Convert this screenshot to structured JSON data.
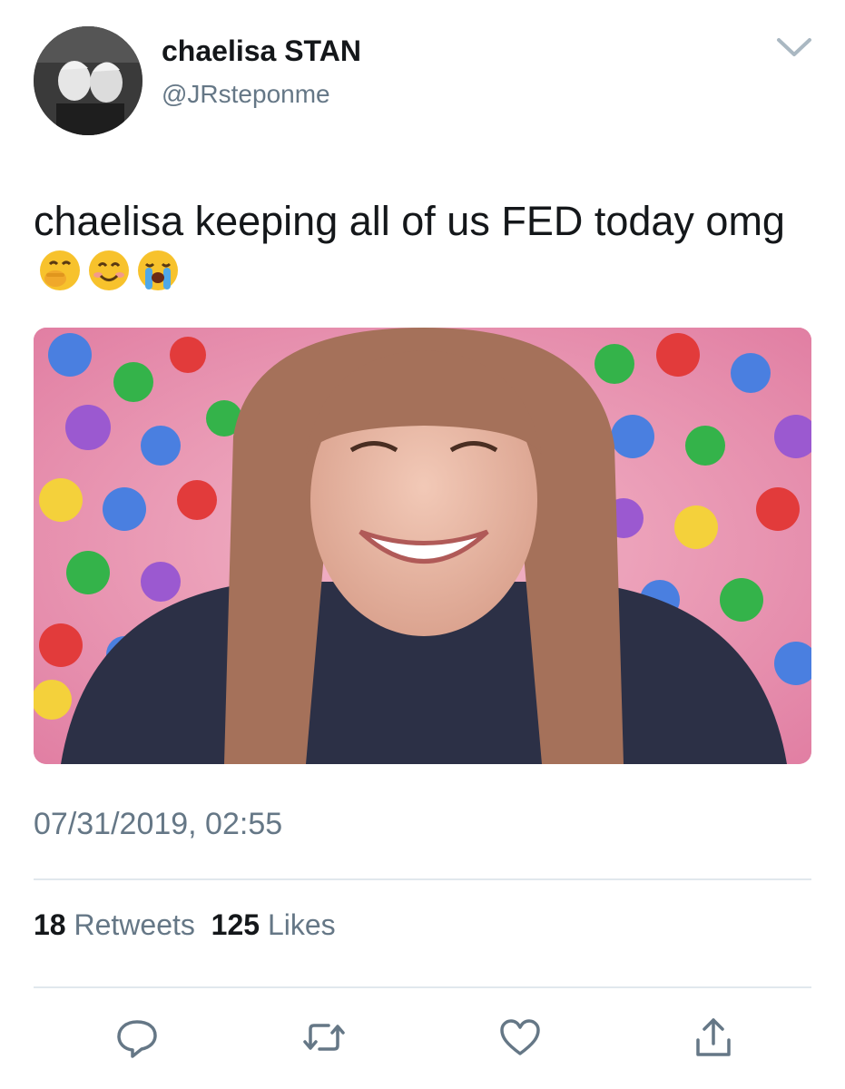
{
  "tweet": {
    "display_name": "chaelisa STAN",
    "handle": "@JRsteponme",
    "text": "chaelisa keeping all of us FED today omg",
    "emojis": [
      "face-with-hand-over-mouth",
      "smiling-face",
      "loudly-crying-face"
    ],
    "timestamp": "07/31/2019, 02:55"
  },
  "stats": {
    "retweets_count": "18",
    "retweets_label": "Retweets",
    "likes_count": "125",
    "likes_label": "Likes"
  },
  "actions": [
    "reply-icon",
    "retweet-icon",
    "like-icon",
    "share-icon"
  ],
  "colors": {
    "text_primary": "#14171a",
    "text_secondary": "#657786",
    "divider": "#e1e8ed",
    "icon": "#657786"
  }
}
